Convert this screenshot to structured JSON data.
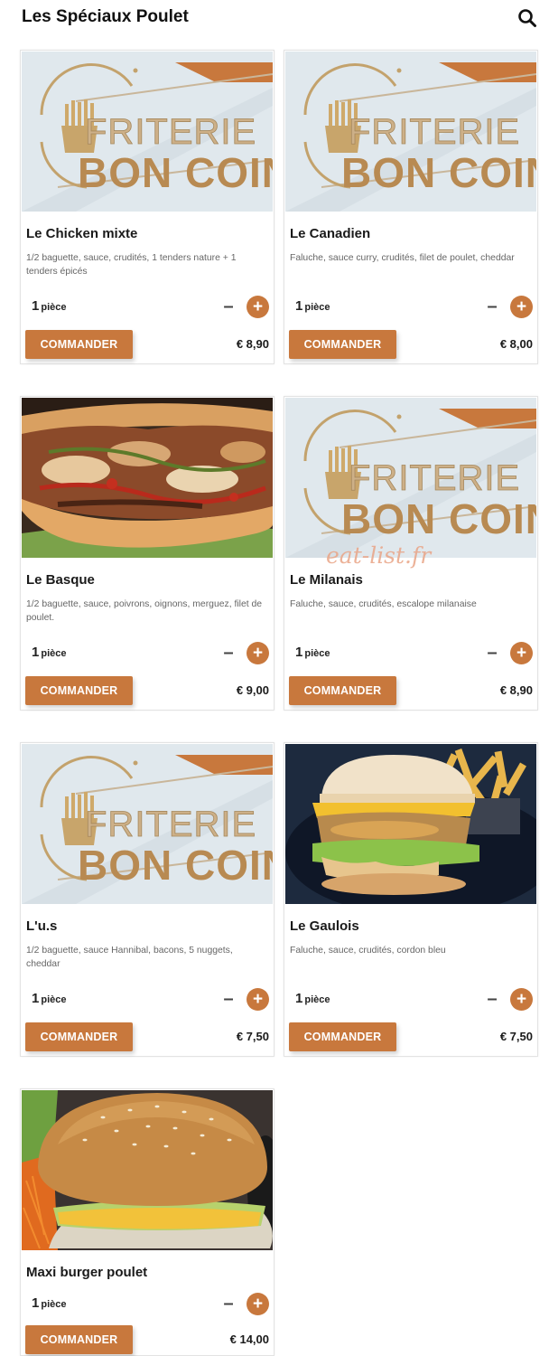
{
  "header": {
    "title": "Les Spéciaux Poulet",
    "search_icon": "search-icon"
  },
  "watermark": "eat-list.fr",
  "colors": {
    "accent": "#c8783d"
  },
  "products": [
    {
      "name": "Le Chicken mixte",
      "description": "1/2 baguette, sauce, crudités, 1 tenders nature + 1 tenders épicés",
      "qty": "1",
      "unit": "pièce",
      "button": "COMMANDER",
      "price": "€ 8,90",
      "image": "friterie-bon-coin-logo"
    },
    {
      "name": "Le Canadien",
      "description": "Faluche, sauce curry, crudités, filet de poulet, cheddar",
      "qty": "1",
      "unit": "pièce",
      "button": "COMMANDER",
      "price": "€ 8,00",
      "image": "friterie-bon-coin-logo"
    },
    {
      "name": "Le Basque",
      "description": "1/2 baguette, sauce, poivrons, oignons, merguez, filet de poulet.",
      "qty": "1",
      "unit": "pièce",
      "button": "COMMANDER",
      "price": "€ 9,00",
      "image": "sandwich-photo"
    },
    {
      "name": "Le Milanais",
      "description": "Faluche, sauce, crudités, escalope milanaise",
      "qty": "1",
      "unit": "pièce",
      "button": "COMMANDER",
      "price": "€ 8,90",
      "image": "friterie-bon-coin-logo"
    },
    {
      "name": "L'u.s",
      "description": "1/2 baguette, sauce Hannibal, bacons, 5 nuggets, cheddar",
      "qty": "1",
      "unit": "pièce",
      "button": "COMMANDER",
      "price": "€ 7,50",
      "image": "friterie-bon-coin-logo"
    },
    {
      "name": "Le Gaulois",
      "description": "Faluche, sauce, crudités, cordon bleu",
      "qty": "1",
      "unit": "pièce",
      "button": "COMMANDER",
      "price": "€ 7,50",
      "image": "burger-fries-photo"
    },
    {
      "name": "Maxi burger poulet",
      "description": "",
      "qty": "1",
      "unit": "pièce",
      "button": "COMMANDER",
      "price": "€ 14,00",
      "image": "burger-photo"
    }
  ]
}
